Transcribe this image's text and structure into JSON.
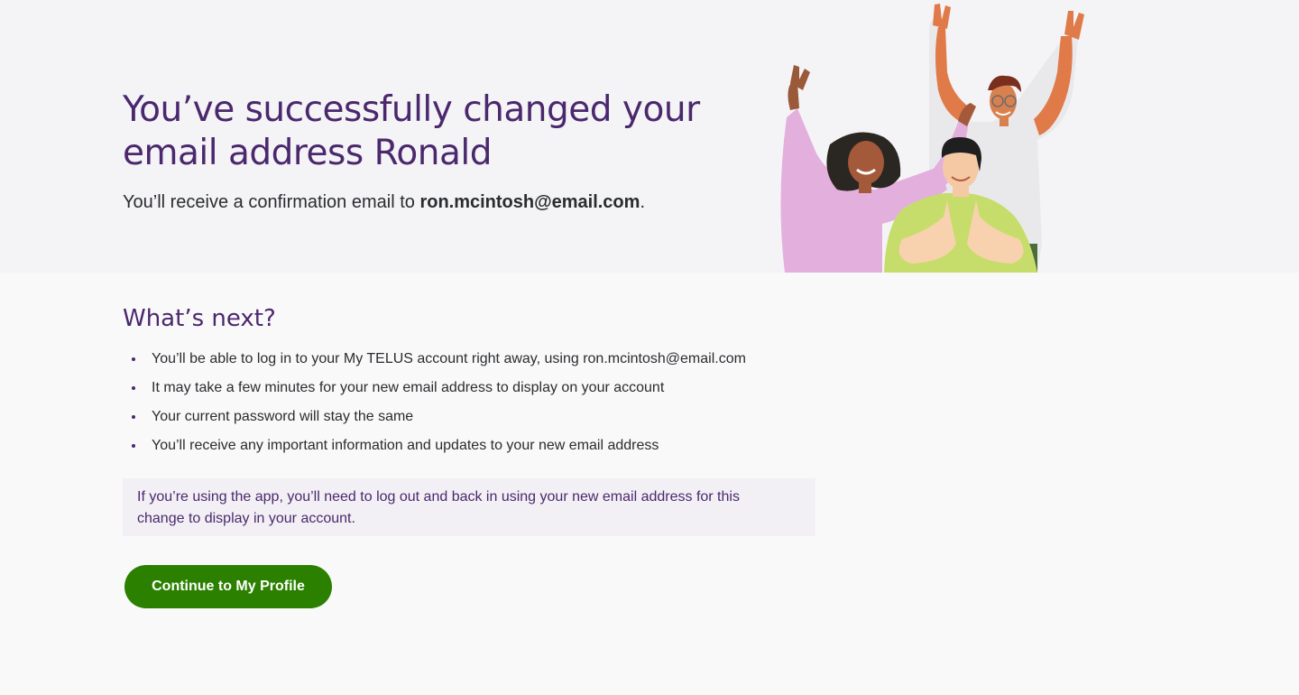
{
  "hero": {
    "title": "You’ve successfully changed your email address Ronald",
    "subtitle_prefix": "You’ll receive a confirmation email to ",
    "email": "ron.mcintosh@email.com",
    "subtitle_suffix": "."
  },
  "next": {
    "heading": "What’s next?",
    "items": [
      "You’ll be able to log in to your My TELUS account right away, using ron.mcintosh@email.com",
      "It may take a few minutes for your new email address to display on your account",
      "Your current password will stay the same",
      "You’ll receive any important information and updates to your new email address"
    ]
  },
  "notice": {
    "text": "If you’re using the app, you’ll need to log out and back in using your new email address for this change to display in your account."
  },
  "cta": {
    "label": "Continue to My Profile"
  },
  "colors": {
    "brand_purple": "#4b286d",
    "cta_green": "#2b8000",
    "hero_bg": "#f4f4f7"
  },
  "icons": {
    "illustration": "celebrating-people-illustration"
  }
}
